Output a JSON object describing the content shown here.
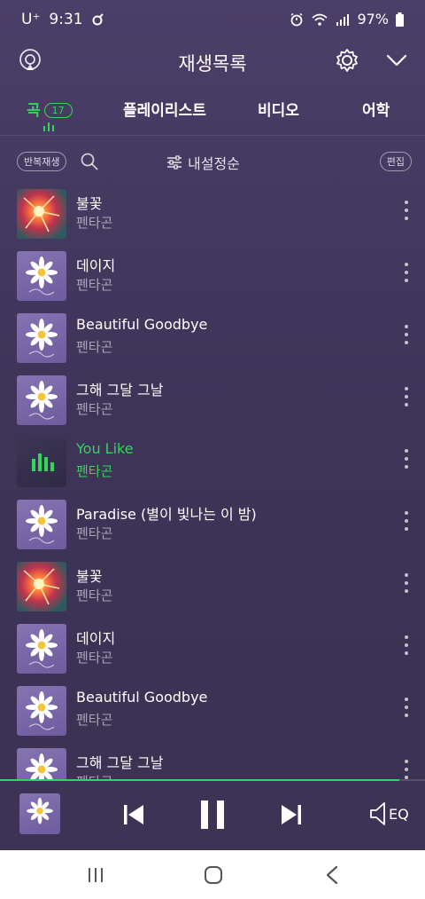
{
  "status_bar": {
    "carrier": "U⁺",
    "time": "9:31",
    "battery": "97%"
  },
  "header": {
    "title": "재생목록"
  },
  "tabs": [
    {
      "label": "곡",
      "count": "17",
      "active": true
    },
    {
      "label": "플레이리스트"
    },
    {
      "label": "비디오"
    },
    {
      "label": "어학"
    }
  ],
  "toolbar": {
    "repeat_label": "반복재생",
    "sort_label": "내설정순",
    "edit_label": "편집"
  },
  "songs": [
    {
      "title": "불꽃",
      "artist": "펜타곤",
      "art": "fire"
    },
    {
      "title": "데이지",
      "artist": "펜타곤",
      "art": "daisy"
    },
    {
      "title": "Beautiful Goodbye",
      "artist": "펜타곤",
      "art": "daisy"
    },
    {
      "title": "그해 그달 그날",
      "artist": "펜타곤",
      "art": "daisy"
    },
    {
      "title": "You Like",
      "artist": "펜타곤",
      "art": "dark",
      "playing": true
    },
    {
      "title": "Paradise (별이 빛나는 이 밤)",
      "artist": "펜타곤",
      "art": "daisy"
    },
    {
      "title": "불꽃",
      "artist": "펜타곤",
      "art": "fire"
    },
    {
      "title": "데이지",
      "artist": "펜타곤",
      "art": "daisy"
    },
    {
      "title": "Beautiful Goodbye",
      "artist": "펜타곤",
      "art": "daisy"
    },
    {
      "title": "그해 그달 그날",
      "artist": "펜타곤",
      "art": "daisy"
    }
  ],
  "player": {
    "progress": 0.94,
    "eq_label": "EQ",
    "state": "playing"
  },
  "colors": {
    "accent": "#33d55a",
    "background": "#3e3458"
  },
  "icons": [
    "cast-icon",
    "gear-icon",
    "chevron-down-icon",
    "search-icon",
    "sort-sliders-icon",
    "more-vert-icon",
    "prev-icon",
    "pause-icon",
    "next-icon",
    "speaker-eq-icon"
  ]
}
